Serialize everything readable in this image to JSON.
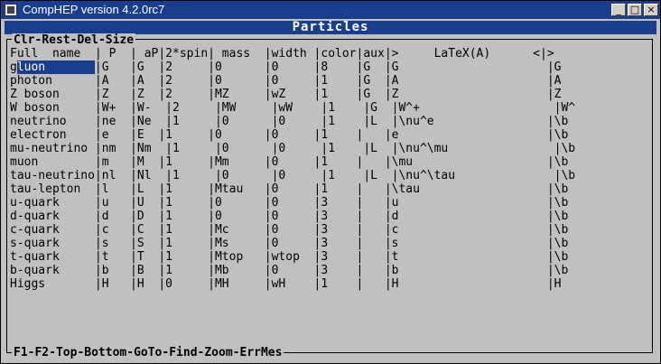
{
  "window": {
    "title": "CompHEP version 4.2.0rc7",
    "buttons": {
      "minimize": "_",
      "maximize": "□",
      "close": "×"
    }
  },
  "screen": {
    "title": "Particles",
    "top_menu": [
      "Clr",
      "Rest",
      "Del",
      "Size"
    ],
    "bottom_menu": [
      "F1",
      "F2",
      "Top",
      "Bottom",
      "GoTo",
      "Find",
      "Zoom",
      "ErrMes"
    ],
    "header": "Full  name  | P  | aP|2*spin| mass  |width |color|aux|>     LaTeX(A)      <|>",
    "rows": [
      "gluon       |G   |G  |2     |0      |0     |8    |G  |G                     |G",
      "photon      |A   |A  |2     |0      |0     |1    |G  |A                     |A",
      "Z boson     |Z   |Z  |2     |MZ     |wZ    |1    |G  |Z                     |Z",
      "W boson     |W+  |W-  |2     |MW     |wW    |1    |G  |W^+                   |W^",
      "neutrino    |ne  |Ne  |1     |0      |0     |1    |L  |\\nu^e                |\\b",
      "electron    |e   |E  |1     |0      |0     |1    |   |e                     |\\b",
      "mu-neutrino |nm  |Nm  |1     |0      |0     |1    |L  |\\nu^\\mu               |\\b",
      "muon        |m   |M  |1     |Mm     |0     |1    |   |\\mu                   |\\b",
      "tau-neutrino|nl  |Nl  |1     |0      |0     |1    |L  |\\nu^\\tau              |\\b",
      "tau-lepton  |l   |L  |1     |Mtau   |0     |1    |   |\\tau                  |\\b",
      "u-quark     |u   |U  |1     |0      |0     |3    |   |u                     |\\b",
      "d-quark     |d   |D  |1     |0      |0     |3    |   |d                     |\\b",
      "c-quark     |c   |C  |1     |Mc     |0     |3    |   |c                     |\\b",
      "s-quark     |s   |S  |1     |Ms     |0     |3    |   |s                     |\\b",
      "t-quark     |t   |T  |1     |Mtop   |wtop  |3    |   |t                     |\\b",
      "b-quark     |b   |B  |1     |Mb     |0     |3    |   |b                     |\\b",
      "Higgs       |H   |H  |0     |MH     |wH    |1    |   |H                     |H"
    ]
  }
}
